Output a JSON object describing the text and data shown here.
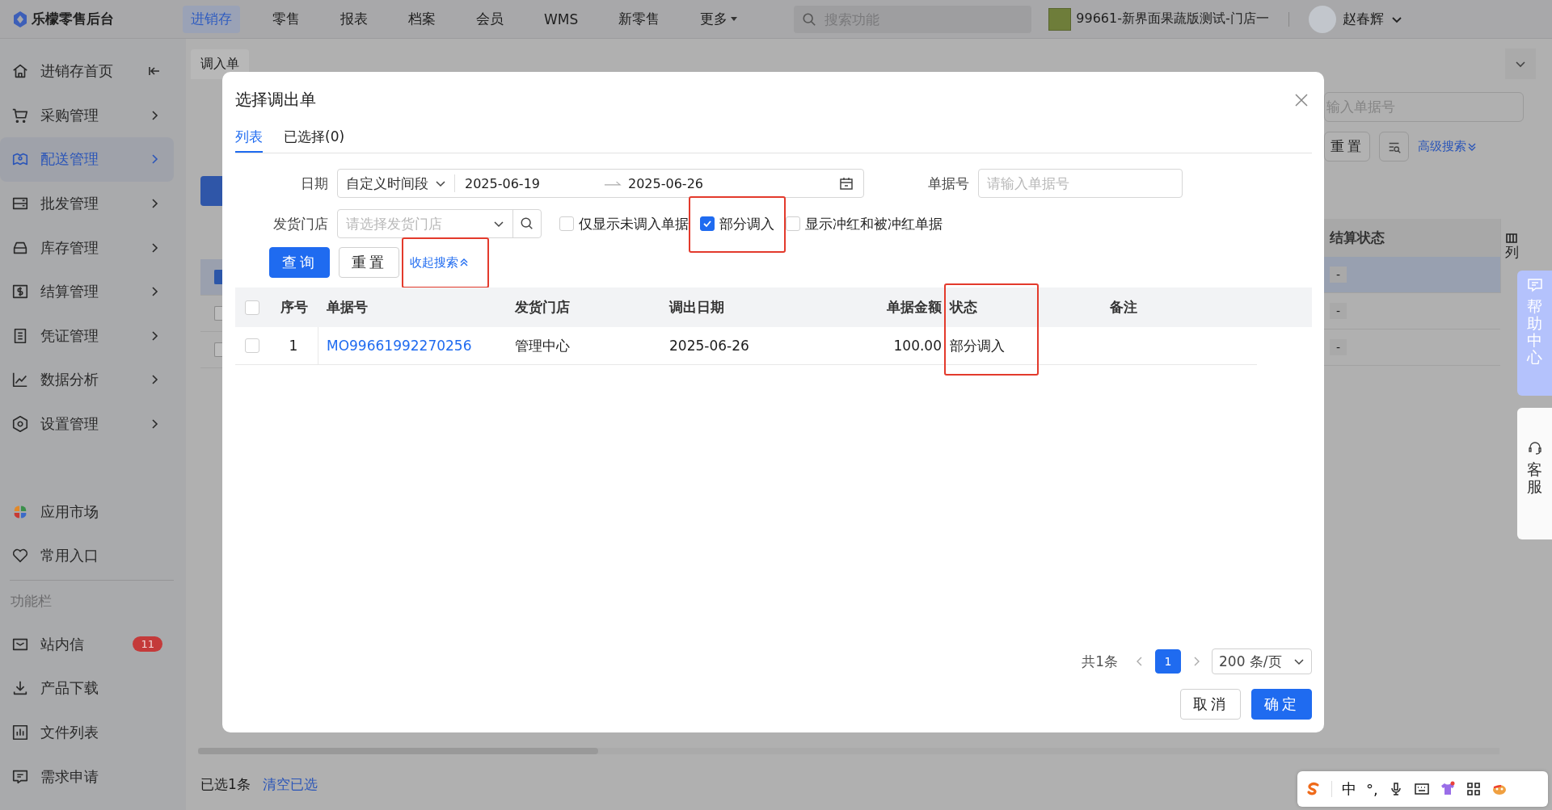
{
  "app": {
    "logo": "乐檬零售后台"
  },
  "top_nav": [
    {
      "label": "进销存",
      "selected": true,
      "kind": "link"
    },
    {
      "label": "零售",
      "selected": false,
      "kind": "link"
    },
    {
      "label": "报表",
      "selected": false,
      "kind": "link"
    },
    {
      "label": "档案",
      "selected": false,
      "kind": "link"
    },
    {
      "label": "会员",
      "selected": false,
      "kind": "link"
    },
    {
      "label": "WMS",
      "selected": false,
      "kind": "link"
    },
    {
      "label": "新零售",
      "selected": false,
      "kind": "link"
    },
    {
      "label": "更多",
      "selected": false,
      "kind": "dropdown"
    }
  ],
  "search": {
    "placeholder": "搜索功能"
  },
  "store": {
    "name": "99661-新界面果蔬版测试-门店一"
  },
  "user": {
    "name": "赵春辉"
  },
  "sidebar": {
    "items": [
      {
        "label": "进销存首页",
        "selected": false,
        "kind": "collapse"
      },
      {
        "label": "采购管理",
        "selected": false,
        "kind": "submenu"
      },
      {
        "label": "配送管理",
        "selected": true,
        "kind": "submenu"
      },
      {
        "label": "批发管理",
        "selected": false,
        "kind": "submenu"
      },
      {
        "label": "库存管理",
        "selected": false,
        "kind": "submenu"
      },
      {
        "label": "结算管理",
        "selected": false,
        "kind": "submenu"
      },
      {
        "label": "凭证管理",
        "selected": false,
        "kind": "submenu"
      },
      {
        "label": "数据分析",
        "selected": false,
        "kind": "submenu"
      },
      {
        "label": "设置管理",
        "selected": false,
        "kind": "submenu"
      }
    ],
    "links": [
      {
        "label": "应用市场"
      },
      {
        "label": "常用入口"
      }
    ],
    "section_label": "功能栏",
    "tools": [
      {
        "label": "站内信",
        "badge": "11"
      },
      {
        "label": "产品下载"
      },
      {
        "label": "文件列表"
      },
      {
        "label": "需求申请"
      }
    ]
  },
  "page": {
    "tab": "调入单",
    "doc_no_placeholder": "输入单据号",
    "reset_button": "重置",
    "advanced_search": "高级搜索",
    "column_header": "结算状态",
    "column_settings": "列",
    "rows": [
      {
        "selected": true,
        "value": "-"
      },
      {
        "selected": false,
        "value": "-"
      },
      {
        "selected": false,
        "value": "-"
      }
    ],
    "selection_count": "已选1条",
    "clear_selection": "清空已选"
  },
  "dialog": {
    "title": "选择调出单",
    "tabs": [
      {
        "label": "列表",
        "selected": true
      },
      {
        "label": "已选择(0)",
        "selected": false
      }
    ],
    "filters": {
      "date_label": "日期",
      "period": "自定义时间段",
      "start_date": "2025-06-19",
      "end_date": "2025-06-26",
      "doc_no_label": "单据号",
      "doc_no_placeholder": "请输入单据号",
      "store_label": "发货门店",
      "store_placeholder": "请选择发货门店",
      "checkboxes": [
        {
          "label": "仅显示未调入单据",
          "checked": false,
          "highlighted": false
        },
        {
          "label": "部分调入",
          "checked": true,
          "highlighted": true
        },
        {
          "label": "显示冲红和被冲红单据",
          "checked": false,
          "highlighted": false
        }
      ]
    },
    "buttons": [
      {
        "label": "查询",
        "kind": "primary"
      },
      {
        "label": "重置",
        "kind": "default"
      }
    ],
    "collapse_link": {
      "label": "收起搜索",
      "highlighted": true
    },
    "table": {
      "all_checked": false,
      "columns": [
        {
          "label": "序号",
          "highlighted": false
        },
        {
          "label": "单据号",
          "highlighted": false
        },
        {
          "label": "发货门店",
          "highlighted": false
        },
        {
          "label": "调出日期",
          "highlighted": false
        },
        {
          "label": "单据金额",
          "highlighted": false
        },
        {
          "label": "状态",
          "highlighted": true
        },
        {
          "label": "备注",
          "highlighted": false
        }
      ],
      "rows": [
        {
          "checked": false,
          "index": "1",
          "doc_no": "MO99661992270256",
          "store": "管理中心",
          "date": "2025-06-26",
          "amount": "100.00",
          "status": "部分调入"
        }
      ]
    },
    "pagination": {
      "total": "共1条",
      "pages": [
        {
          "label": "1",
          "selected": true
        }
      ],
      "page_size": "200 条/页"
    },
    "footer_buttons": [
      {
        "label": "取消",
        "kind": "default"
      },
      {
        "label": "确定",
        "kind": "primary"
      }
    ]
  },
  "help": {
    "help_center": "帮助中心",
    "service": "客服"
  },
  "ime": {
    "mode": "中",
    "punctuation": "°,"
  }
}
